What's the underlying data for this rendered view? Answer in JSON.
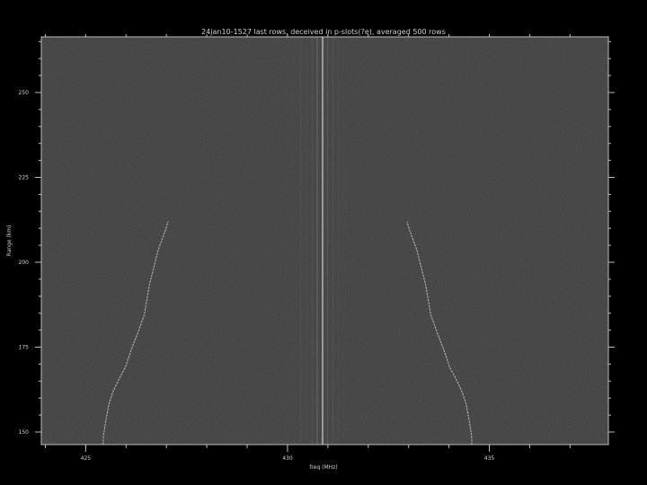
{
  "chart_data": {
    "type": "line",
    "title": "24jan10-1527 last rows, deceived in p-slots(?e), averaged 500 rows",
    "xlabel": "freq (MHz)",
    "ylabel": "Range (km)",
    "x_ticks": [
      "425",
      "430",
      "435"
    ],
    "x_tick_values": [
      425,
      430,
      435
    ],
    "y_ticks": [
      "150",
      "175",
      "200",
      "225",
      "250"
    ],
    "y_tick_values": [
      150,
      175,
      200,
      225,
      250
    ],
    "xlim": [
      423.9,
      437.95
    ],
    "ylim": [
      146.3,
      266.4
    ],
    "grid": false,
    "background": "#3a3a3a",
    "line_color": "#cfcfcf",
    "series": [
      {
        "x": [
          425.43,
          425.44,
          425.5,
          425.58,
          425.68,
          425.82,
          425.98,
          426.12,
          426.3,
          426.45,
          426.58,
          426.8,
          426.98,
          427.04
        ],
        "y": [
          146.3,
          149,
          153.5,
          158.5,
          162,
          165.5,
          169,
          174,
          179.5,
          184.5,
          193.5,
          203.8,
          209.6,
          212
        ]
      },
      {
        "x": [
          434.57,
          434.56,
          434.5,
          434.42,
          434.32,
          434.18,
          434.02,
          433.88,
          433.7,
          433.55,
          433.42,
          433.2,
          433.02,
          432.96
        ],
        "y": [
          146.3,
          149,
          153.5,
          158.5,
          162,
          165.5,
          169,
          174,
          179.5,
          184.5,
          193.5,
          203.8,
          209.6,
          212
        ]
      }
    ]
  }
}
